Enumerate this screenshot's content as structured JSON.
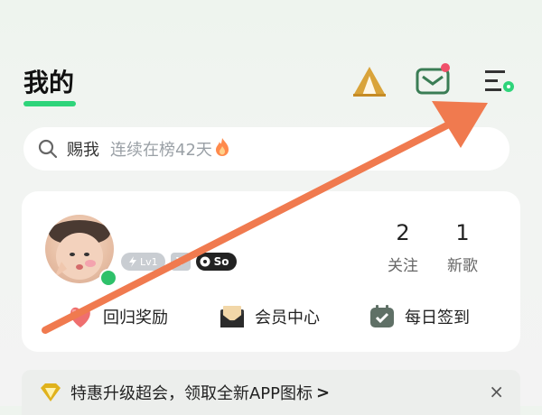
{
  "header": {
    "title": "我的"
  },
  "icons": {
    "tent": "tent-icon",
    "mail": "mail-icon",
    "settings": "settings-menu-icon",
    "search": "search-icon"
  },
  "search": {
    "main_text": "赐我",
    "sub_text": "连续在榜42天"
  },
  "profile": {
    "badges": {
      "level": "Lv1",
      "vip": "V",
      "so": "So"
    },
    "stats": [
      {
        "value": "2",
        "label": "关注"
      },
      {
        "value": "1",
        "label": "新歌"
      }
    ],
    "quick_actions": [
      {
        "label": "回归奖励",
        "icon": "gift-heart-icon"
      },
      {
        "label": "会员中心",
        "icon": "envelope-icon"
      },
      {
        "label": "每日签到",
        "icon": "calendar-check-icon"
      }
    ]
  },
  "promo": {
    "text": "特惠升级超会，领取全新APP图标",
    "chevron": ">",
    "close": "×"
  },
  "colors": {
    "accent_green": "#2ed47a",
    "arrow": "#f07a4f",
    "badge_red": "#f0506a"
  }
}
